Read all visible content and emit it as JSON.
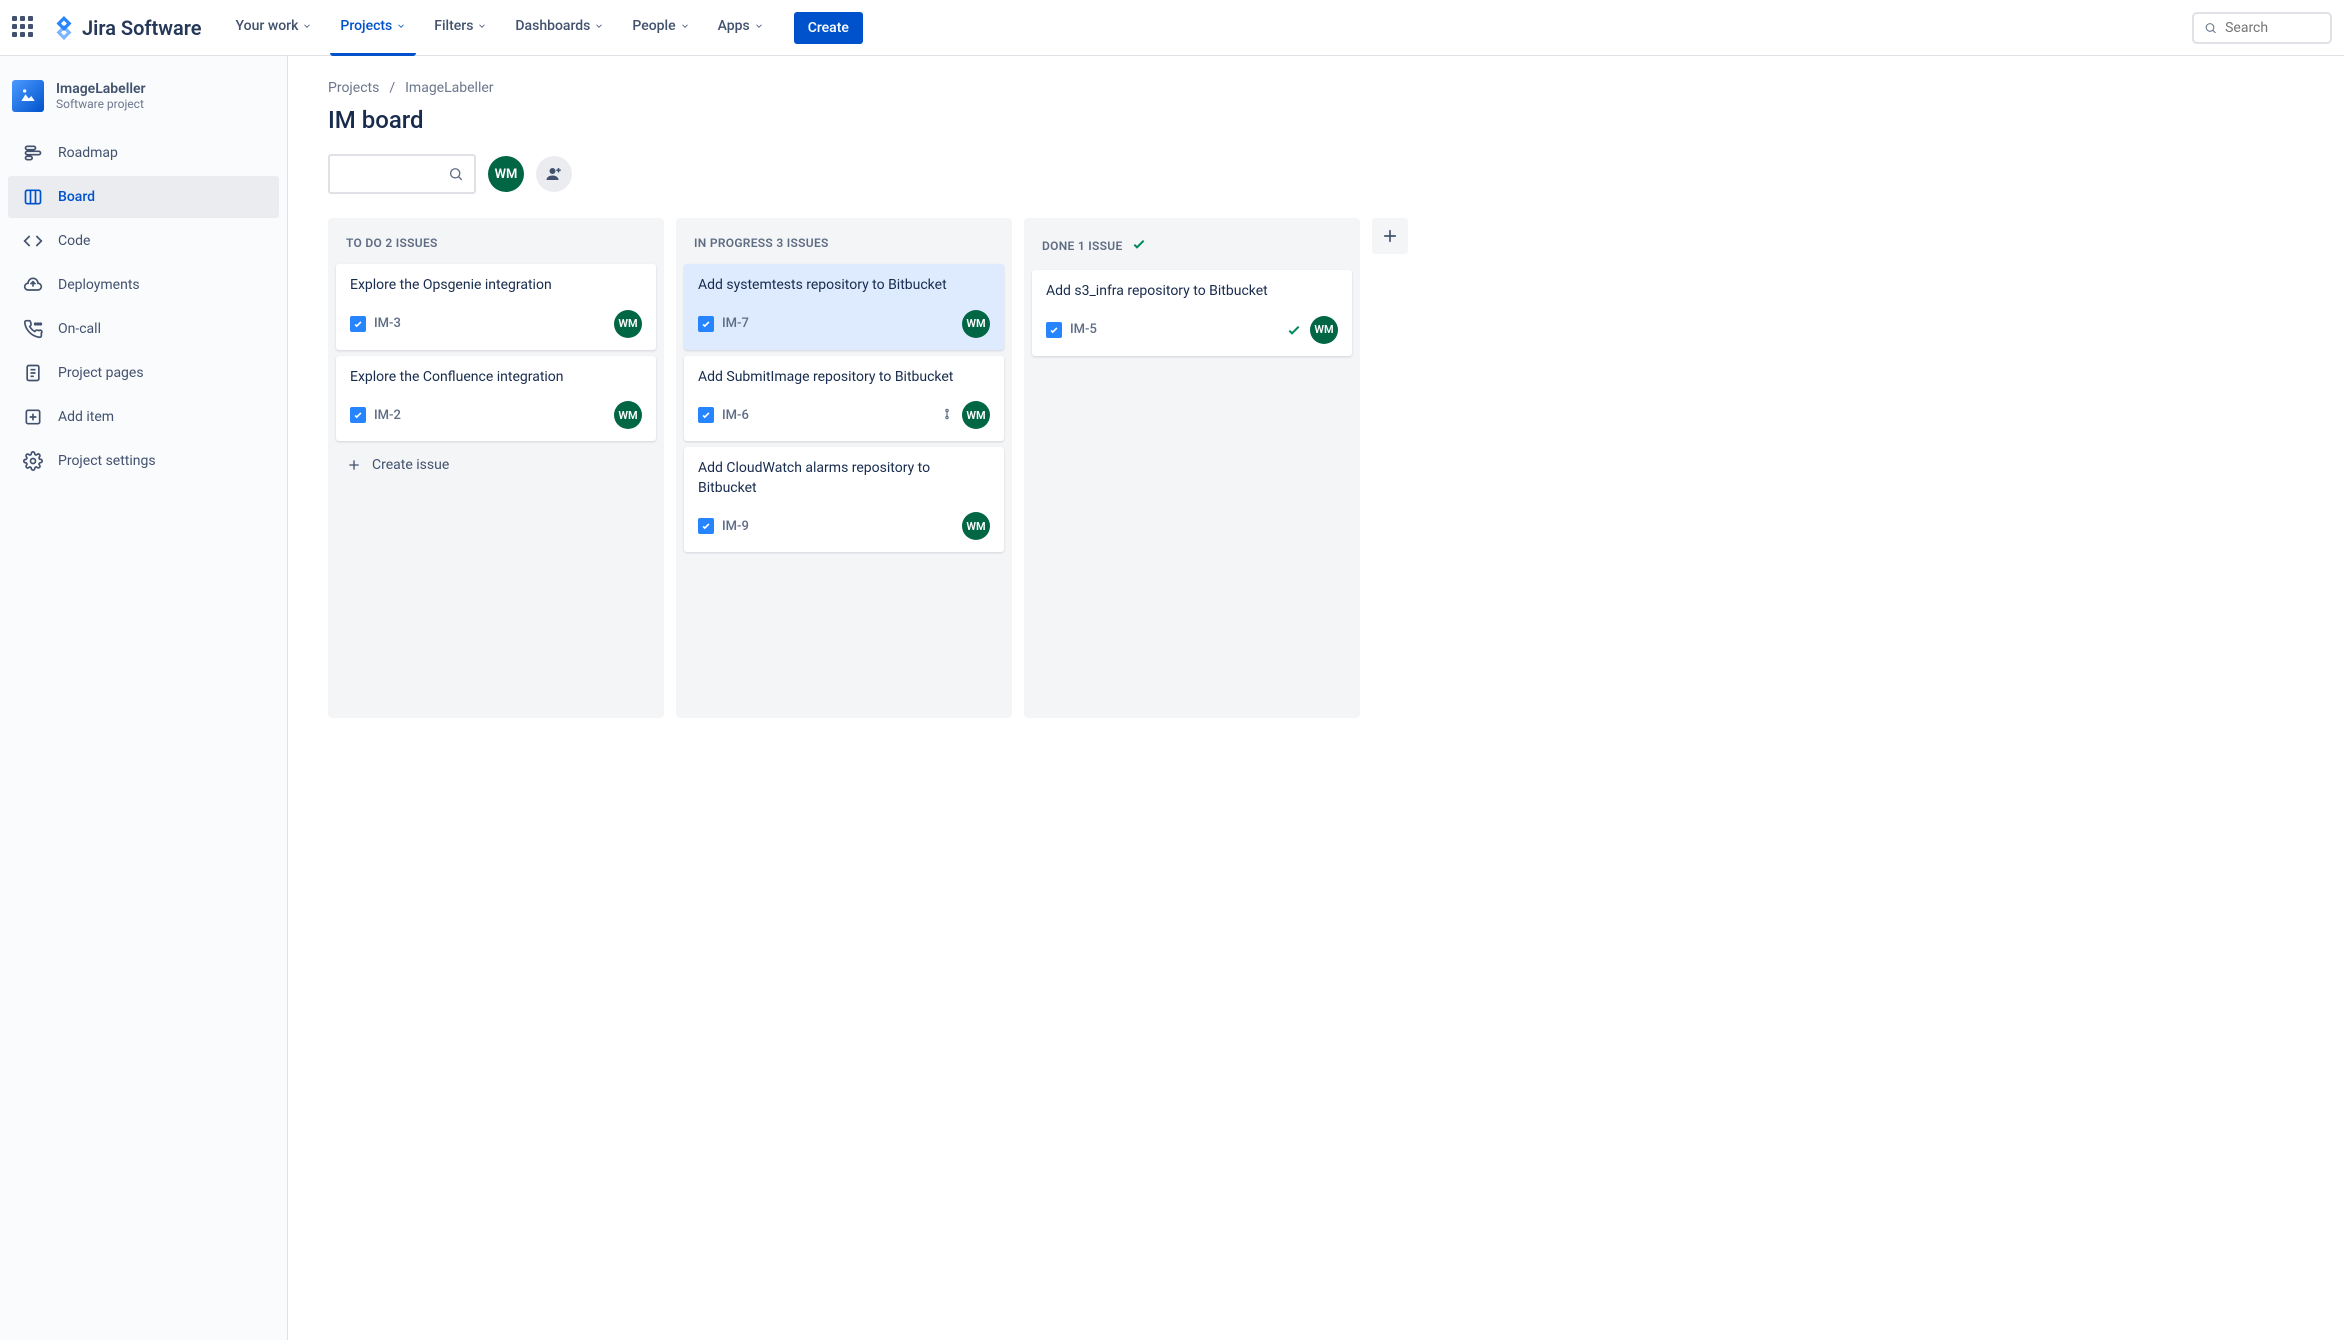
{
  "nav": {
    "logo_text": "Jira Software",
    "items": [
      "Your work",
      "Projects",
      "Filters",
      "Dashboards",
      "People",
      "Apps"
    ],
    "active_index": 1,
    "create_label": "Create",
    "search_placeholder": "Search"
  },
  "sidebar": {
    "project_name": "ImageLabeller",
    "project_type": "Software project",
    "items": [
      {
        "label": "Roadmap",
        "icon": "roadmap"
      },
      {
        "label": "Board",
        "icon": "board",
        "active": true
      },
      {
        "label": "Code",
        "icon": "code"
      },
      {
        "label": "Deployments",
        "icon": "deployments"
      },
      {
        "label": "On-call",
        "icon": "oncall"
      },
      {
        "label": "Project pages",
        "icon": "pages"
      },
      {
        "label": "Add item",
        "icon": "add"
      },
      {
        "label": "Project settings",
        "icon": "settings"
      }
    ]
  },
  "breadcrumb": {
    "items": [
      "Projects",
      "ImageLabeller"
    ]
  },
  "page_title": "IM board",
  "user_initials": "WM",
  "board": {
    "columns": [
      {
        "title": "TO DO 2 ISSUES",
        "done": false,
        "cards": [
          {
            "title": "Explore the Opsgenie integration",
            "key": "IM-3",
            "assignee": "WM"
          },
          {
            "title": "Explore the Confluence integration",
            "key": "IM-2",
            "assignee": "WM"
          }
        ],
        "create_label": "Create issue"
      },
      {
        "title": "IN PROGRESS 3 ISSUES",
        "done": false,
        "cards": [
          {
            "title": "Add systemtests repository to Bitbucket",
            "key": "IM-7",
            "assignee": "WM",
            "selected": true
          },
          {
            "title": "Add SubmitImage repository to Bitbucket",
            "key": "IM-6",
            "assignee": "WM",
            "priority": true
          },
          {
            "title": "Add CloudWatch alarms repository to Bitbucket",
            "key": "IM-9",
            "assignee": "WM"
          }
        ]
      },
      {
        "title": "DONE 1 ISSUE",
        "done": true,
        "cards": [
          {
            "title": "Add s3_infra repository to Bitbucket",
            "key": "IM-5",
            "assignee": "WM",
            "done_check": true
          }
        ]
      }
    ]
  }
}
